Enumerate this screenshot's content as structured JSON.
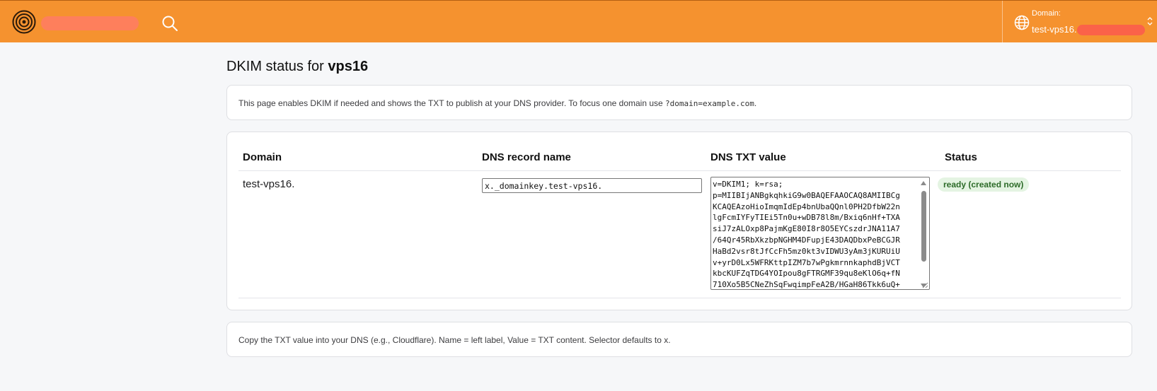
{
  "header": {
    "domain_label": "Domain:",
    "domain_value": "test-vps16.",
    "icons": [
      "logo-icon",
      "search-icon",
      "globe-icon",
      "chevron-updown-icon"
    ],
    "bar_color": "#f5922f"
  },
  "page": {
    "title_prefix": "DKIM status for",
    "title_domain": "vps16",
    "intro_text": "This page enables DKIM if needed and shows the TXT to publish at your DNS provider. To focus one domain use",
    "intro_code": "?domain=example.com",
    "intro_end": ".",
    "footer_text": "Copy the TXT value into your DNS (e.g., Cloudflare). Name = left label, Value = TXT content. Selector defaults to x."
  },
  "table": {
    "headers": {
      "domain": "Domain",
      "record_name": "DNS record name",
      "txt_value": "DNS TXT value",
      "status": "Status"
    },
    "rows": [
      {
        "domain": "test-vps16.",
        "record_name": "x._domainkey.test-vps16.",
        "txt_value": "v=DKIM1; k=rsa;\np=MIIBIjANBgkqhkiG9w0BAQEFAAOCAQ8AMIIBCg\nKCAQEAzoHioImqmIdEp4bnUbaQQnl0PH2DfbW22n\nlgFcmIYFyTIEi5Tn0u+wDB78l8m/Bxiq6nHf+TXA\nsiJ7zALOxp8PajmKgE80I8r8O5EYCszdrJNA11A7\n/64Qr45RbXkzbpNGHM4DFupjE43DAQDbxPeBCGJR\nHaBd2vsr8tJfCcFh5mz0kt3vIDWU3yAm3jKURUiU\nv+yrD0Lx5WFRKttpIZM7b7wPgkmrnnkaphdBjVCT\nkbcKUFZqTDG4YOIpou8gFTRGMF39qu8eKlO6q+fN\n710Xo5B5CNeZhSqFwqimpFeA2B/HGaH86Tkk6uQ+",
        "status": "ready (created now)"
      }
    ]
  },
  "colors": {
    "status_bg": "#e4f4e2",
    "status_text": "#2c6b28"
  }
}
